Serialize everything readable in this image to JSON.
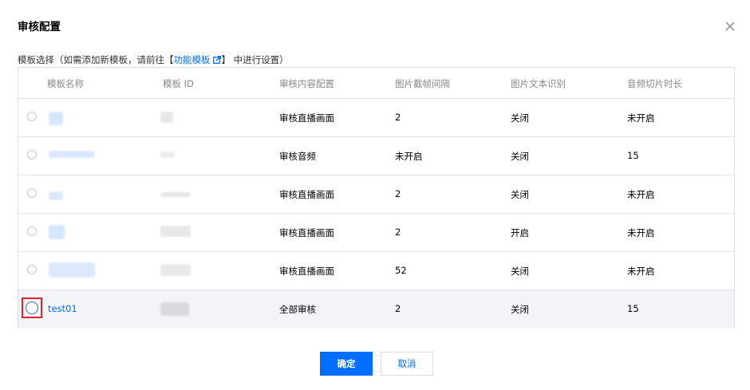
{
  "dialog": {
    "title": "审核配置",
    "close_icon": "close-icon"
  },
  "hint": {
    "prefix": "模板选择（如需添加新模板，请前往",
    "bracket_open": "【",
    "link_text": "功能模板",
    "link_icon": "external-link-icon",
    "bracket_close": "】",
    "suffix": "中进行设置）"
  },
  "table": {
    "columns": [
      "模板名称",
      "模板 ID",
      "审核内容配置",
      "图片截帧间隔",
      "图片文本识别",
      "音频切片时长"
    ],
    "rows": [
      {
        "name": "",
        "id": "",
        "content": "审核直播画面",
        "interval": "2",
        "ocr": "关闭",
        "audio": "未开启"
      },
      {
        "name": "",
        "id": "",
        "content": "审核音频",
        "interval": "未开启",
        "ocr": "关闭",
        "audio": "15"
      },
      {
        "name": "",
        "id": "",
        "content": "审核直播画面",
        "interval": "2",
        "ocr": "关闭",
        "audio": "未开启"
      },
      {
        "name": "",
        "id": "",
        "content": "审核直播画面",
        "interval": "2",
        "ocr": "开启",
        "audio": "未开启"
      },
      {
        "name": "",
        "id": "",
        "content": "审核直播画面",
        "interval": "52",
        "ocr": "关闭",
        "audio": "未开启"
      },
      {
        "name": "test01",
        "id": "",
        "content": "全部审核",
        "interval": "2",
        "ocr": "关闭",
        "audio": "15"
      }
    ]
  },
  "buttons": {
    "confirm": "确定",
    "cancel": "取消"
  },
  "colors": {
    "accent": "#006eff",
    "highlight": "#e0232b"
  }
}
